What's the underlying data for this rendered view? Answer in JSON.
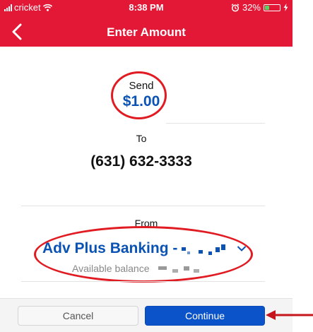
{
  "status_bar": {
    "carrier": "cricket",
    "time": "8:38 PM",
    "battery": "32%",
    "battery_level": 0.32
  },
  "nav": {
    "title": "Enter Amount"
  },
  "send": {
    "label": "Send",
    "amount": "$1.00"
  },
  "to": {
    "label": "To",
    "recipient": "(631) 632-3333"
  },
  "from": {
    "label": "From",
    "account_name": "Adv Plus Banking -",
    "balance_label": "Available balance"
  },
  "actions": {
    "cancel_label": "Cancel",
    "continue_label": "Continue"
  },
  "colors": {
    "header": "#e31837",
    "accent_blue": "#0a53b5",
    "button_blue": "#0a53c9",
    "annotation_red": "#e11b22"
  },
  "icons": [
    "signal-icon",
    "wifi-icon",
    "alarm-icon",
    "battery-icon",
    "bolt-icon",
    "back-chevron-icon",
    "chevron-down-icon"
  ]
}
